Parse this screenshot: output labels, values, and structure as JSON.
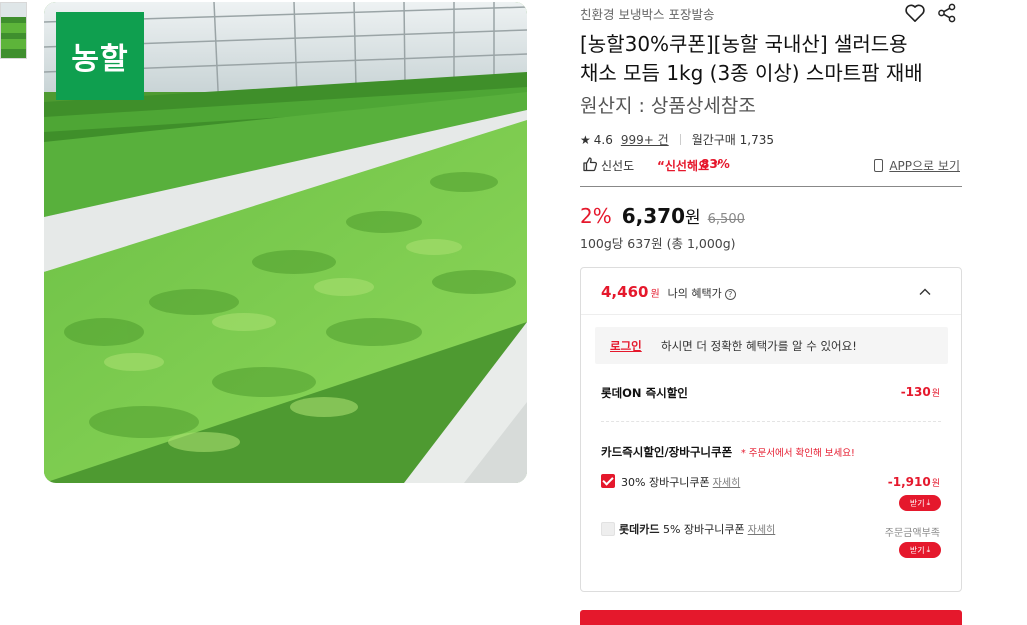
{
  "gallery": {
    "brand_badge": "농할"
  },
  "product": {
    "shipping_tag": "친환경 보냉박스 포장발송",
    "title_line1": "[농할30%쿠폰][농할 국내산] 샐러드용",
    "title_line2": "채소 모듬 1kg (3종 이상) 스마트팜 재배",
    "origin": "원산지 : 상품상세참조",
    "rating": "4.6",
    "review_count": "999+ 건",
    "monthly_sales": "월간구매 1,735",
    "freshness_label": "신선도",
    "freshness_value": "“신선해요 ”",
    "freshness_pct": "83%",
    "app_link": "APP으로 보기"
  },
  "price": {
    "discount": "2%",
    "amount": "6,370",
    "currency": "원",
    "original": "6,500",
    "unit_price": "100g당 637원 (총 1,000g)"
  },
  "benefit": {
    "price": "4,460",
    "won": "원",
    "label": "나의 혜택가",
    "login_link": "로그인",
    "login_msg": "하시면 더 정확한 혜택가를 알 수 있어요!",
    "instant_label": "롯데ON 즉시할인",
    "instant_value": "-130",
    "card_label": "카드즉시할인/장바구니쿠폰",
    "card_note": "* 주문서에서 확인해 보세요!",
    "coupon1_text": "30% 장바구니쿠폰",
    "coupon1_detail": "자세히",
    "coupon1_value": "-1,910",
    "coupon1_checked": true,
    "coupon2_brand": "롯데카드",
    "coupon2_text": "5% 장바구니쿠폰",
    "coupon2_detail": "자세히",
    "coupon2_note": "주문금액부족",
    "coupon2_checked": false,
    "get_button": "받기"
  },
  "colors": {
    "accent": "#e5182c",
    "brand_green": "#0f9f4f"
  }
}
